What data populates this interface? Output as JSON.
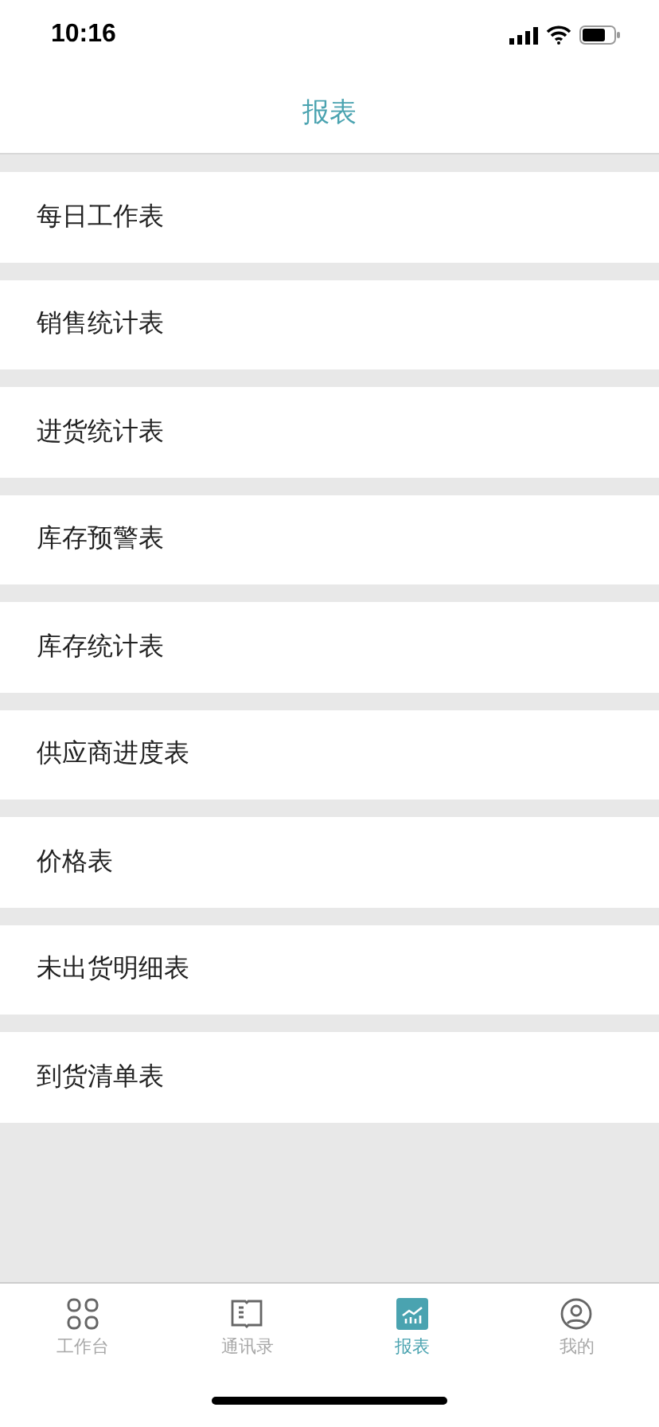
{
  "status_bar": {
    "time": "10:16"
  },
  "header": {
    "title": "报表"
  },
  "reports": [
    {
      "label": "每日工作表"
    },
    {
      "label": "销售统计表"
    },
    {
      "label": "进货统计表"
    },
    {
      "label": "库存预警表"
    },
    {
      "label": "库存统计表"
    },
    {
      "label": "供应商进度表"
    },
    {
      "label": "价格表"
    },
    {
      "label": "未出货明细表"
    },
    {
      "label": "到货清单表"
    }
  ],
  "tab_bar": [
    {
      "kind": "grid",
      "label": "工作台",
      "selected": false
    },
    {
      "kind": "book",
      "label": "通讯录",
      "selected": false
    },
    {
      "kind": "chart",
      "label": "报表",
      "selected": true
    },
    {
      "kind": "user",
      "label": "我的",
      "selected": false
    }
  ]
}
